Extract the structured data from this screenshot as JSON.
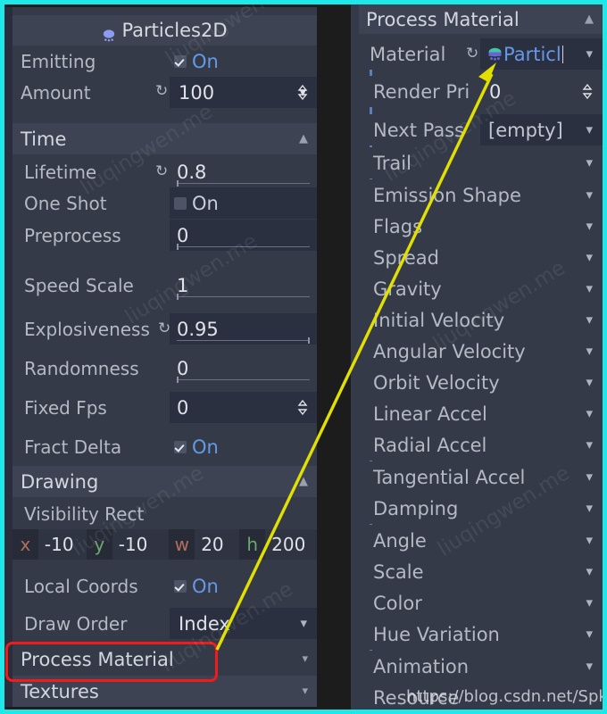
{
  "window": {
    "accent_border_color": "#1ee8e8",
    "panel_bg": "#353a48",
    "row_alt_bg": "#2b3040",
    "header_bg": "#3d4352",
    "link_color": "#6698e8",
    "highlight_box_color": "#f21b1b",
    "arrow_color": "#e2e000"
  },
  "inspector": {
    "node_title": "Particles2D",
    "node_icon": "particles2d-icon",
    "properties": [
      {
        "label": "Emitting",
        "type": "bool",
        "value": "On",
        "checked": true,
        "revert": false
      },
      {
        "label": "Amount",
        "type": "int",
        "value": "100",
        "revert": true,
        "spinner": true
      },
      {
        "label": "Time",
        "type": "section",
        "collapse_icon": "chevron-up"
      },
      {
        "label": "Lifetime",
        "type": "float",
        "value": "0.8",
        "revert": true,
        "slider": "left"
      },
      {
        "label": "One Shot",
        "type": "bool",
        "value": "On",
        "checked": false,
        "revert": false
      },
      {
        "label": "Preprocess",
        "type": "float",
        "value": "0",
        "revert": false,
        "slider": "left"
      },
      {
        "label": "Speed Scale",
        "type": "float",
        "value": "1",
        "revert": false,
        "slider": "left"
      },
      {
        "label": "Explosiveness",
        "type": "float",
        "value": "0.95",
        "revert": true,
        "slider": "right"
      },
      {
        "label": "Randomness",
        "type": "float",
        "value": "0",
        "revert": false,
        "slider": "left"
      },
      {
        "label": "Fixed Fps",
        "type": "int",
        "value": "0",
        "revert": false,
        "spinner": true
      },
      {
        "label": "Fract Delta",
        "type": "bool",
        "value": "On",
        "checked": true,
        "revert": false
      },
      {
        "label": "Drawing",
        "type": "section",
        "collapse_icon": "chevron-up"
      },
      {
        "label": "Visibility Rect",
        "type": "label"
      }
    ],
    "visibility_rect": [
      {
        "axis": "x",
        "value": "-10",
        "color": "#b0705c"
      },
      {
        "axis": "y",
        "value": "-10",
        "color": "#6aa86f"
      },
      {
        "axis": "w",
        "value": "20",
        "color": "#b0705c"
      },
      {
        "axis": "h",
        "value": "200",
        "color": "#6aa86f"
      }
    ],
    "properties_tail": [
      {
        "label": "Local Coords",
        "type": "bool",
        "value": "On",
        "checked": true
      },
      {
        "label": "Draw Order",
        "type": "enum",
        "value": "Index"
      },
      {
        "label": "Process Material",
        "type": "section",
        "highlighted": true,
        "collapse_icon": "chevron-down"
      },
      {
        "label": "Textures",
        "type": "section",
        "collapse_icon": "chevron-down"
      }
    ]
  },
  "process_material": {
    "header": "Process Material",
    "header_collapse_icon": "chevron-up",
    "rows": [
      {
        "label": "Material",
        "type": "resource",
        "value": "Particl",
        "revert": true,
        "icon": "particles-material-icon",
        "dropdown": true
      },
      {
        "label": "Render Pri",
        "type": "int",
        "value": "0",
        "spinner": true
      },
      {
        "label": "Next Pass",
        "type": "resource",
        "value": "[empty]",
        "dropdown": true
      },
      {
        "label": "Trail",
        "type": "group",
        "collapse_icon": "chevron-down"
      },
      {
        "label": "Emission Shape",
        "type": "group",
        "collapse_icon": "chevron-down"
      },
      {
        "label": "Flags",
        "type": "group",
        "collapse_icon": "chevron-down"
      },
      {
        "label": "Spread",
        "type": "group",
        "collapse_icon": "chevron-down"
      },
      {
        "label": "Gravity",
        "type": "group",
        "collapse_icon": "chevron-down"
      },
      {
        "label": "Initial Velocity",
        "type": "group",
        "collapse_icon": "chevron-down"
      },
      {
        "label": "Angular Velocity",
        "type": "group",
        "collapse_icon": "chevron-down"
      },
      {
        "label": "Orbit Velocity",
        "type": "group",
        "collapse_icon": "chevron-down"
      },
      {
        "label": "Linear Accel",
        "type": "group",
        "collapse_icon": "chevron-down"
      },
      {
        "label": "Radial Accel",
        "type": "group",
        "collapse_icon": "chevron-down"
      },
      {
        "label": "Tangential Accel",
        "type": "group",
        "collapse_icon": "chevron-down"
      },
      {
        "label": "Damping",
        "type": "group",
        "collapse_icon": "chevron-down"
      },
      {
        "label": "Angle",
        "type": "group",
        "collapse_icon": "chevron-down"
      },
      {
        "label": "Scale",
        "type": "group",
        "collapse_icon": "chevron-down"
      },
      {
        "label": "Color",
        "type": "group",
        "collapse_icon": "chevron-down"
      },
      {
        "label": "Hue Variation",
        "type": "group",
        "collapse_icon": "chevron-down"
      },
      {
        "label": "Animation",
        "type": "group",
        "collapse_icon": "chevron-down"
      },
      {
        "label": "Resource",
        "type": "group",
        "collapse_icon": "chevron-down"
      }
    ]
  },
  "annotations": {
    "arrow_from": "process-material-row",
    "arrow_to": "material-resource-field",
    "watermark_url": "https://blog.csdn.net/SpkingR",
    "watermark_text": "liuqingwen.me"
  }
}
